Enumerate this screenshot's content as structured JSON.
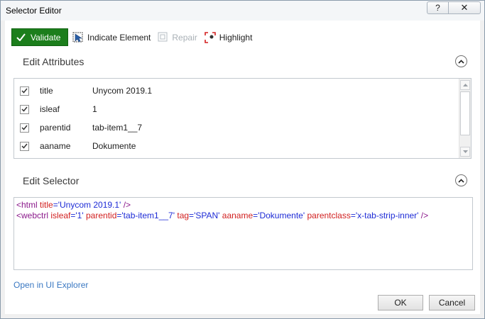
{
  "window": {
    "title": "Selector Editor",
    "help_label": "?",
    "close_label": "✕"
  },
  "toolbar": {
    "validate_label": "Validate",
    "indicate_label": "Indicate Element",
    "repair_label": "Repair",
    "highlight_label": "Highlight"
  },
  "edit_attributes": {
    "title": "Edit Attributes",
    "rows": [
      {
        "name": "title",
        "value": "Unycom 2019.1",
        "checked": true
      },
      {
        "name": "isleaf",
        "value": "1",
        "checked": true
      },
      {
        "name": "parentid",
        "value": "tab-item1__7",
        "checked": true
      },
      {
        "name": "aaname",
        "value": "Dokumente",
        "checked": true
      }
    ]
  },
  "edit_selector": {
    "title": "Edit Selector",
    "line1": {
      "open": "<html ",
      "attr1": "title",
      "eq1": "=",
      "val1": "'Unycom 2019.1'",
      "close": " />"
    },
    "line2": {
      "open": "<webctrl ",
      "a1": "isleaf",
      "v1": "'1'",
      "a2": "parentid",
      "v2": "'tab-item1__7'",
      "a3": "tag",
      "v3": "'SPAN'",
      "a4": "aaname",
      "v4": "'Dokumente'",
      "a5": "parentclass",
      "v5": "'x-tab-strip-inner'",
      "eq": "=",
      "close": " />"
    }
  },
  "footer": {
    "open_link": "Open in UI Explorer",
    "ok_label": "OK",
    "cancel_label": "Cancel"
  },
  "colors": {
    "validate_green": "#1c7e1c",
    "link_blue": "#3a78c2",
    "tag_purple": "#8b1a8b",
    "attr_red": "#d11f1f",
    "value_blue": "#1d2bd6"
  }
}
